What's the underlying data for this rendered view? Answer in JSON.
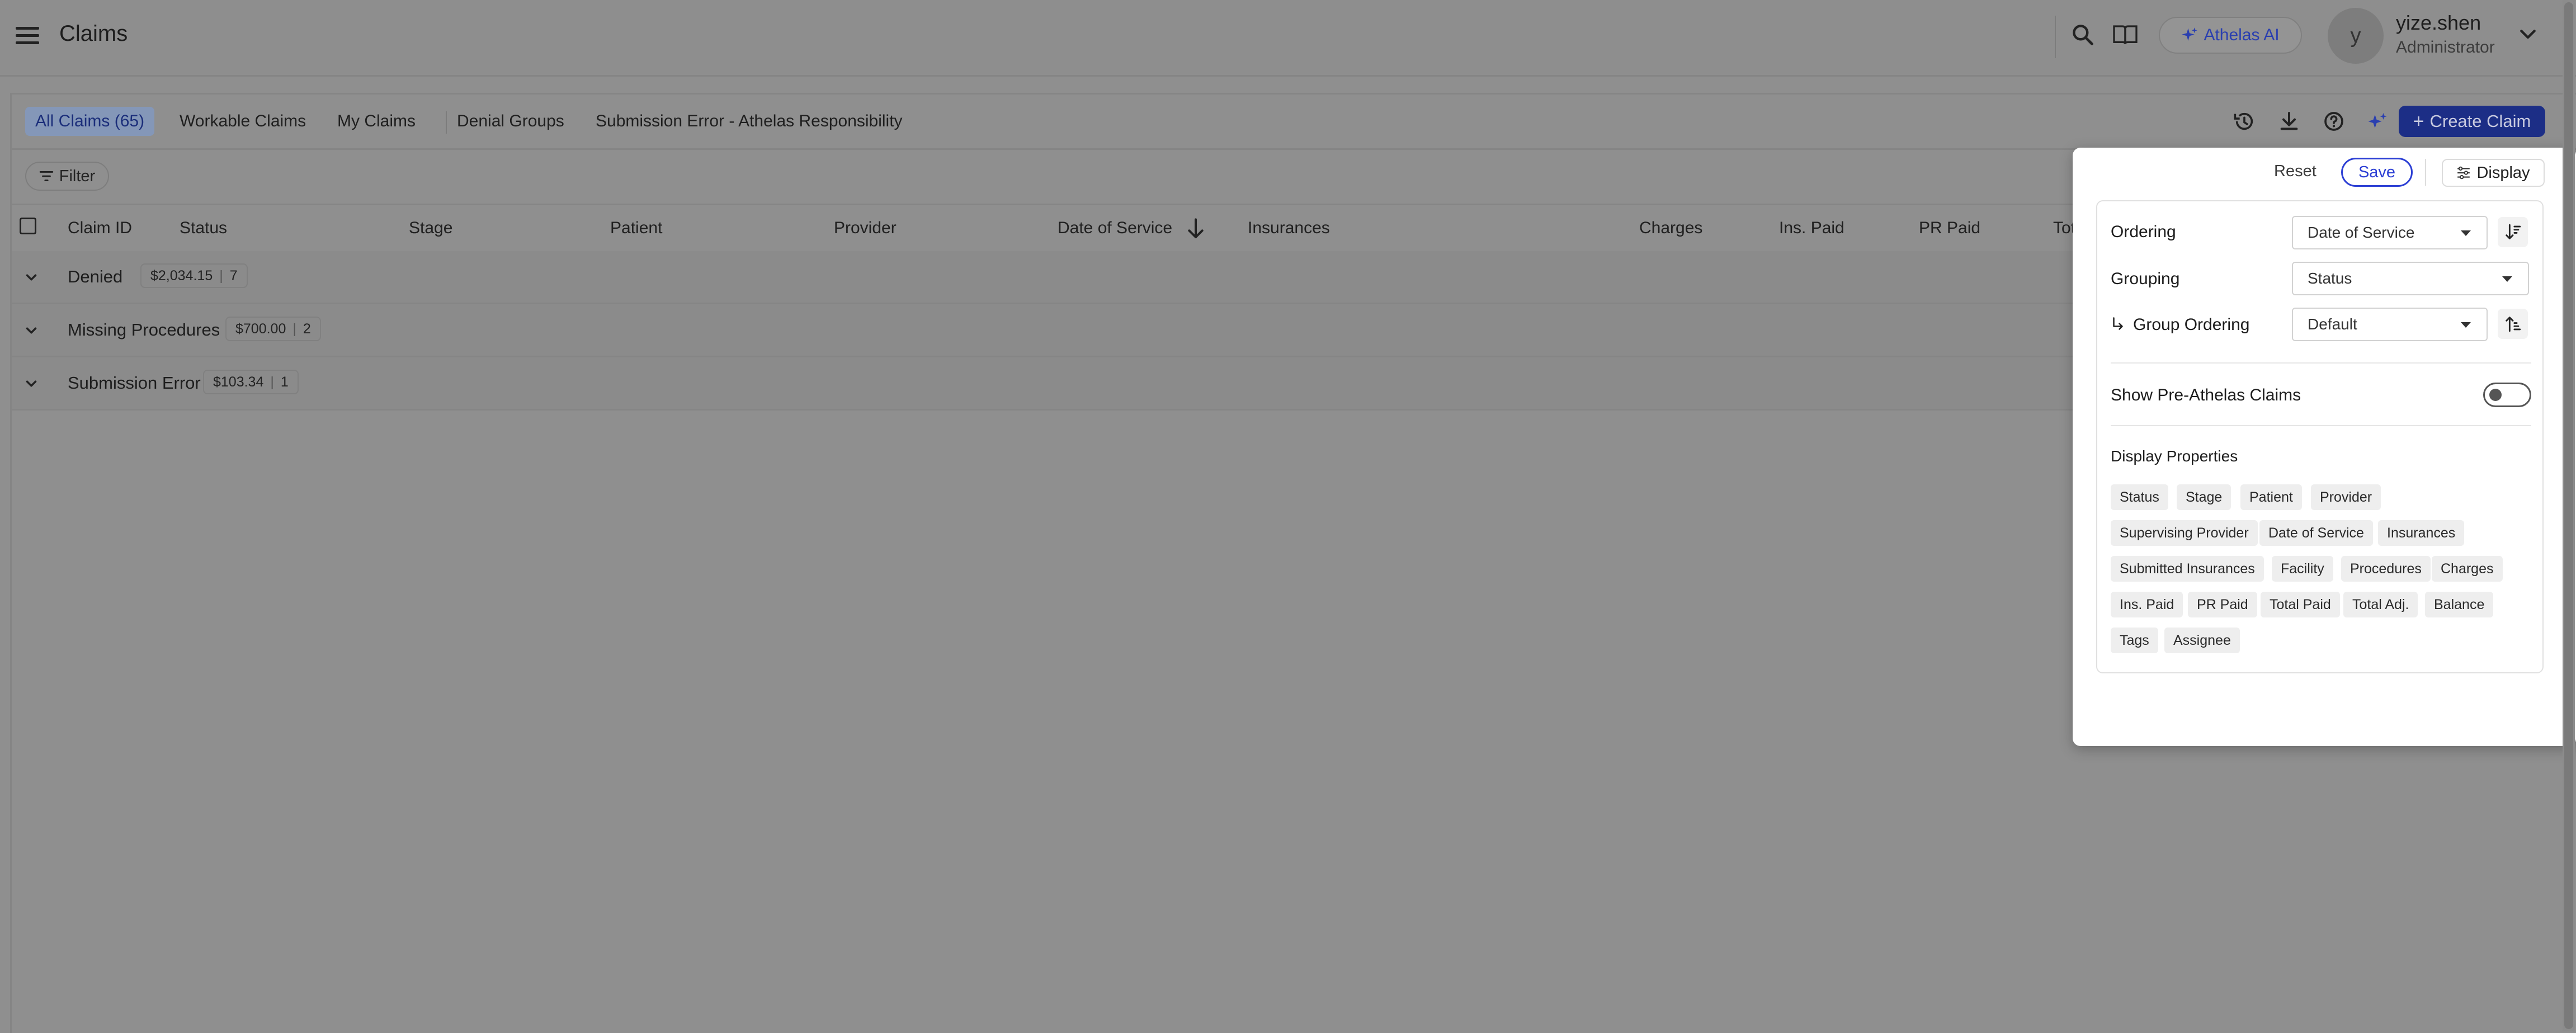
{
  "header": {
    "title": "Claims",
    "ai_label": "Athelas AI",
    "user": {
      "initial": "y",
      "name": "yize.shen",
      "role": "Administrator"
    }
  },
  "tabs": [
    {
      "label": "All Claims",
      "count": "(65)"
    },
    {
      "label": "Workable Claims"
    },
    {
      "label": "My Claims"
    },
    {
      "label": "Denial Groups"
    },
    {
      "label": "Submission Error - Athelas Responsibility"
    }
  ],
  "toolbar": {
    "create_label": "Create Claim",
    "filter_label": "Filter"
  },
  "columns": [
    "Claim ID",
    "Status",
    "Stage",
    "Patient",
    "Provider",
    "Date of Service",
    "Insurances",
    "Charges",
    "Ins. Paid",
    "PR Paid",
    "Total A"
  ],
  "groups": [
    {
      "label": "Denied",
      "amount": "$2,034.15",
      "count": "7"
    },
    {
      "label": "Missing Procedures",
      "amount": "$700.00",
      "count": "2"
    },
    {
      "label": "Submission Error",
      "amount": "$103.34",
      "count": "1"
    }
  ],
  "panel": {
    "reset_label": "Reset",
    "save_label": "Save",
    "display_label": "Display",
    "ordering": {
      "label": "Ordering",
      "value": "Date of Service"
    },
    "grouping": {
      "label": "Grouping",
      "value": "Status"
    },
    "group_ordering": {
      "label": "Group Ordering",
      "value": "Default"
    },
    "pre_athelas": {
      "label": "Show Pre-Athelas Claims",
      "enabled": false
    },
    "properties_title": "Display Properties",
    "properties": [
      "Status",
      "Stage",
      "Patient",
      "Provider",
      "Supervising Provider",
      "Date of Service",
      "Insurances",
      "Submitted Insurances",
      "Facility",
      "Procedures",
      "Charges",
      "Ins. Paid",
      "PR Paid",
      "Total Paid",
      "Total Adj.",
      "Balance",
      "Tags",
      "Assignee"
    ]
  },
  "colors": {
    "primary": "#1c2e86",
    "save_outline": "#2c3fd4",
    "overlay_bg": "#8f8f8f",
    "panel_bg": "#ffffff"
  }
}
